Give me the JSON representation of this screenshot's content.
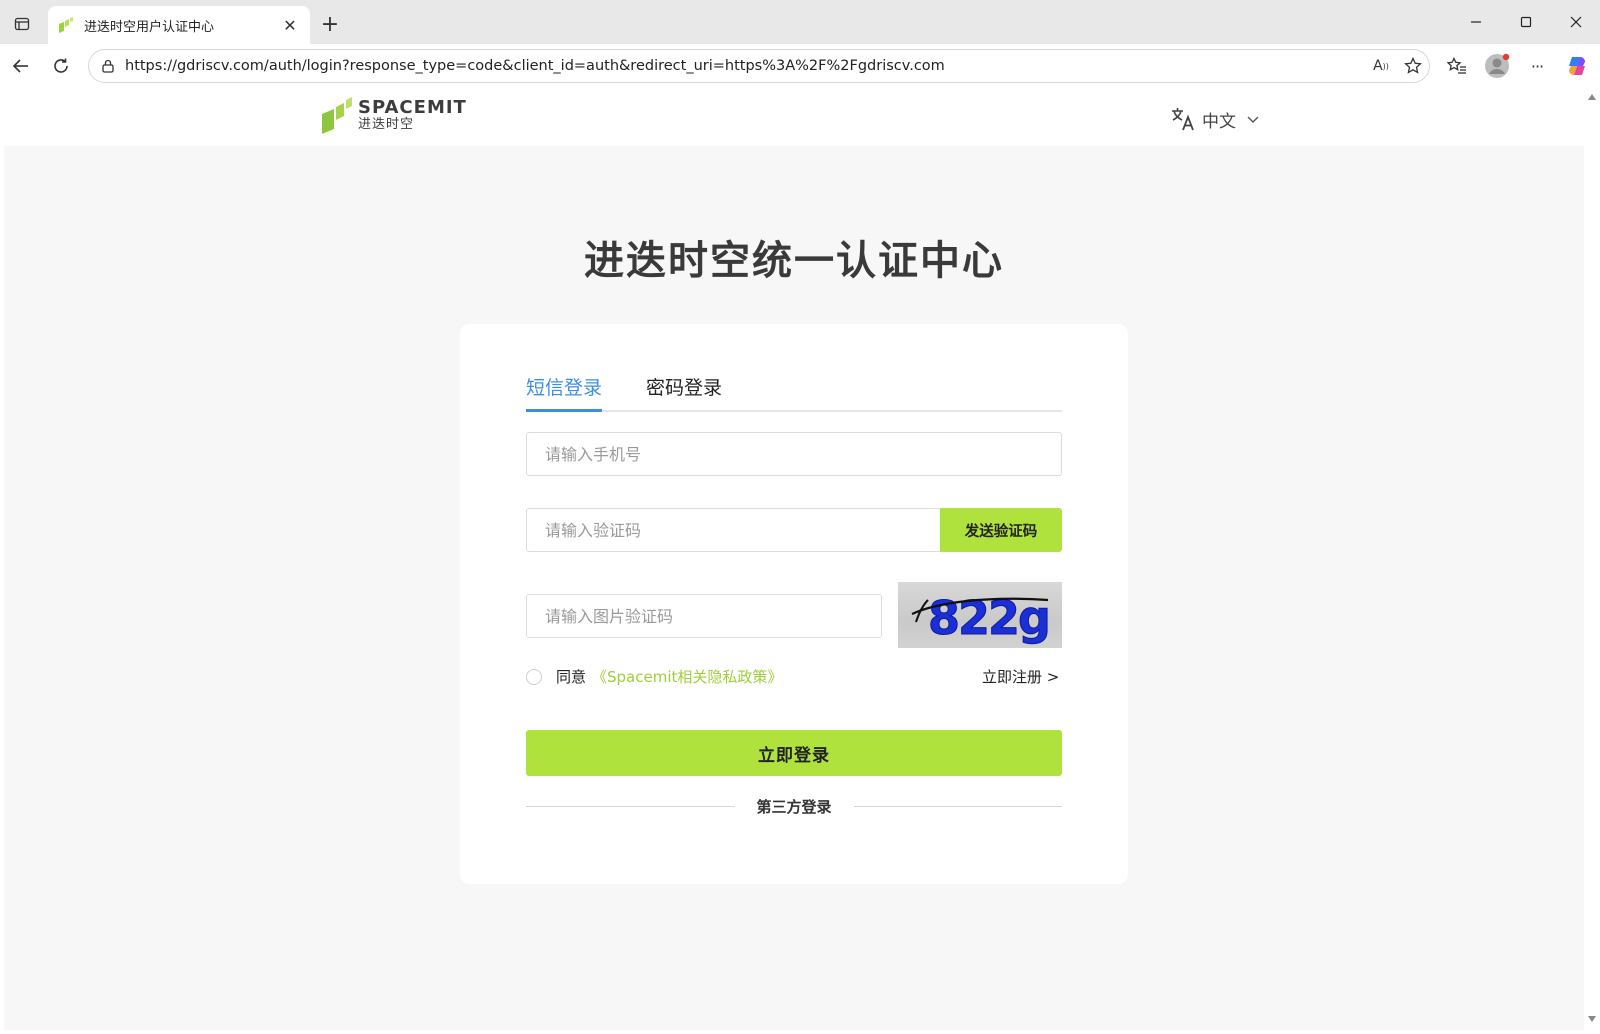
{
  "browser": {
    "tab_title": "进迭时空用户认证中心",
    "url": "https://gdriscv.com/auth/login?response_type=code&client_id=auth&redirect_uri=https%3A%2F%2Fgdriscv.com",
    "tab_close_glyph": "✕",
    "new_tab_glyph": "+",
    "more_glyph": "···",
    "read_aloud_glyph": "A"
  },
  "header": {
    "logo_en": "SPACEMIT",
    "logo_cn": "进迭时空",
    "language": "中文"
  },
  "main": {
    "title": "进迭时空统一认证中心"
  },
  "login_card": {
    "tabs": [
      {
        "label": "短信登录",
        "active": true
      },
      {
        "label": "密码登录",
        "active": false
      }
    ],
    "phone_placeholder": "请输入手机号",
    "sms_code_placeholder": "请输入验证码",
    "send_code_label": "发送验证码",
    "captcha_placeholder": "请输入图片验证码",
    "captcha_text": "822g",
    "agree_label": "同意",
    "policy_link": "《Spacemit相关隐私政策》",
    "register_link": "立即注册 >",
    "login_button": "立即登录",
    "third_party_label": "第三方登录"
  },
  "colors": {
    "accent_green": "#b0e23e",
    "tab_active_blue": "#3c8fe0",
    "policy_green": "#9ecf3a",
    "captcha_blue": "#1a2fd6"
  }
}
